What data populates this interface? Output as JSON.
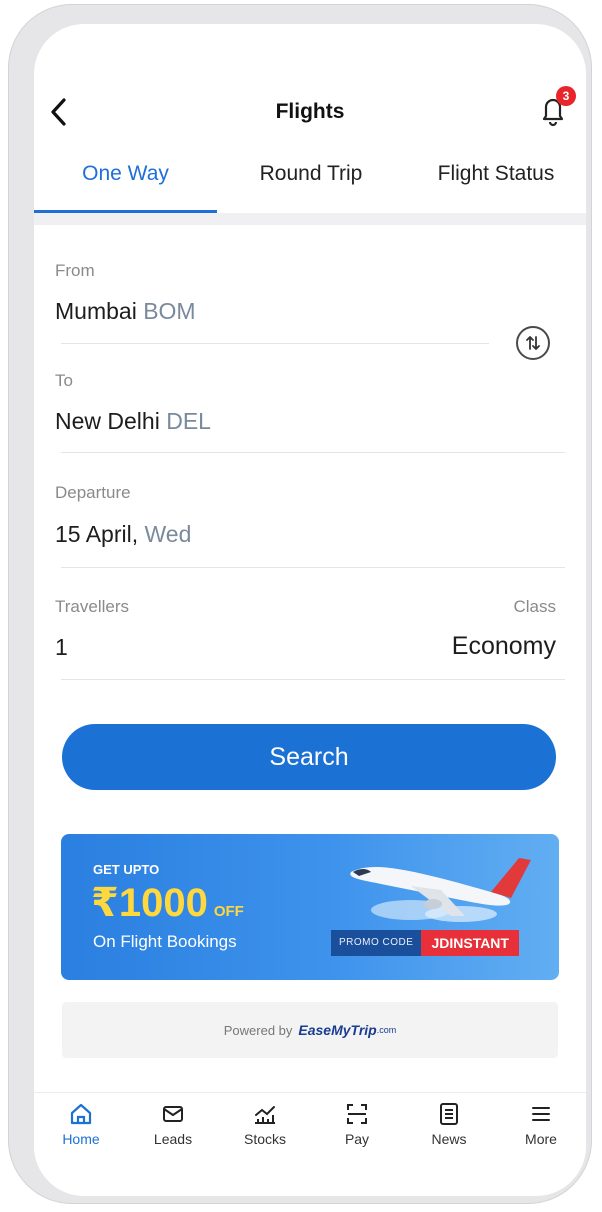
{
  "header": {
    "title": "Flights",
    "notification_count": "3"
  },
  "tabs": [
    {
      "label": "One Way",
      "active": true
    },
    {
      "label": "Round Trip",
      "active": false
    },
    {
      "label": "Flight Status",
      "active": false
    }
  ],
  "form": {
    "from": {
      "label": "From",
      "city": "Mumbai",
      "code": "BOM"
    },
    "to": {
      "label": "To",
      "city": "New Delhi",
      "code": "DEL"
    },
    "departure": {
      "label": "Departure",
      "date": "15 April,",
      "day": "Wed"
    },
    "travellers": {
      "label": "Travellers",
      "value": "1"
    },
    "class": {
      "label": "Class",
      "value": "Economy"
    },
    "search_label": "Search"
  },
  "banner": {
    "line1": "GET UPTO",
    "amount": "₹1000",
    "off": "OFF",
    "line3": "On Flight Bookings",
    "promo_label": "PROMO CODE",
    "promo_code": "JDINSTANT"
  },
  "powered": {
    "text": "Powered by",
    "brand": "EaseMyTrip",
    "brand_suffix": ".com"
  },
  "bottom_nav": [
    {
      "label": "Home",
      "icon": "home-icon",
      "active": true
    },
    {
      "label": "Leads",
      "icon": "mail-icon",
      "active": false
    },
    {
      "label": "Stocks",
      "icon": "stocks-icon",
      "active": false
    },
    {
      "label": "Pay",
      "icon": "scan-icon",
      "active": false
    },
    {
      "label": "News",
      "icon": "news-icon",
      "active": false
    },
    {
      "label": "More",
      "icon": "menu-icon",
      "active": false
    }
  ],
  "colors": {
    "accent": "#1c72d4",
    "badge": "#e8252b",
    "promo_red": "#e8303a"
  }
}
